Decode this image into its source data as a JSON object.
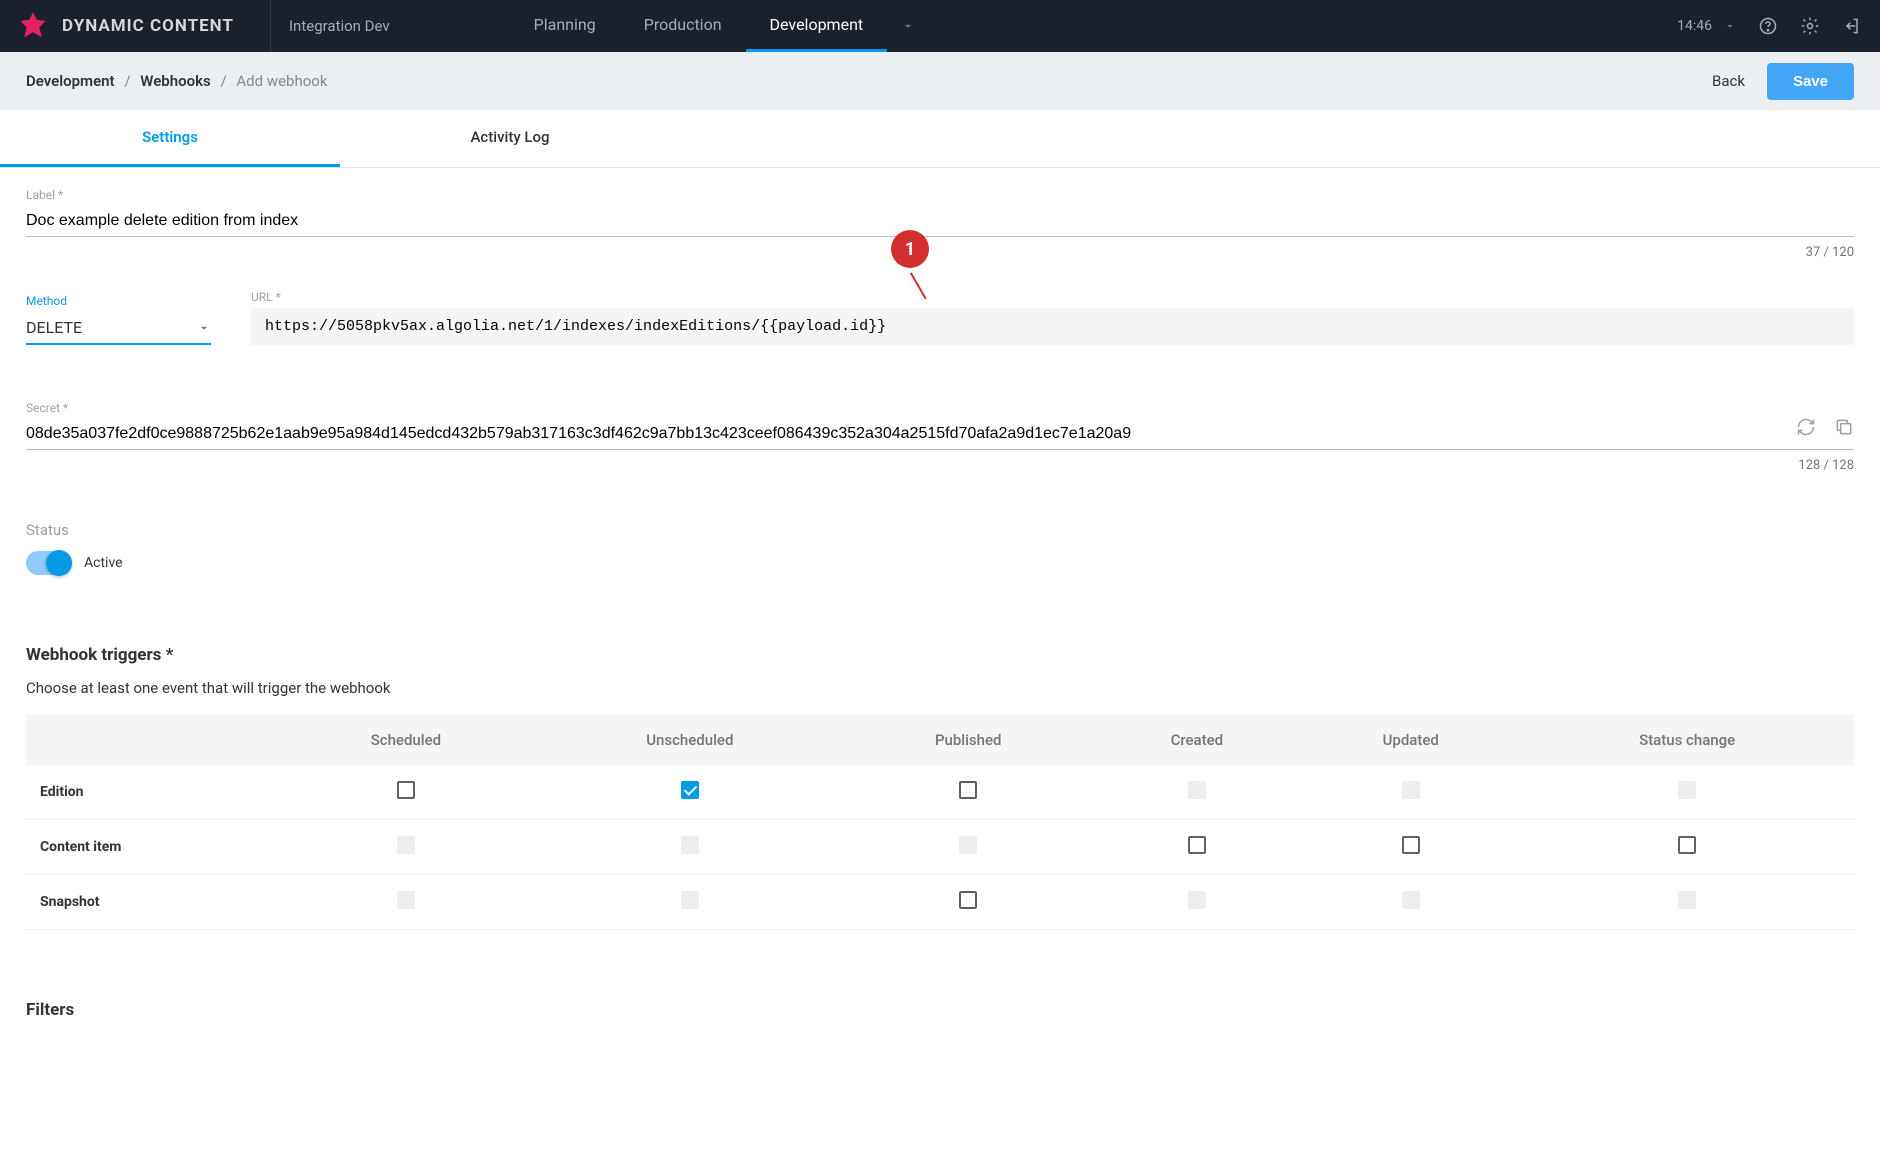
{
  "topnav": {
    "brand": "DYNAMIC CONTENT",
    "hub": "Integration Dev",
    "tabs": [
      {
        "label": "Planning",
        "active": false
      },
      {
        "label": "Production",
        "active": false
      },
      {
        "label": "Development",
        "active": true
      }
    ],
    "time": "14:46"
  },
  "subheader": {
    "crumbs": [
      {
        "label": "Development",
        "link": true
      },
      {
        "label": "Webhooks",
        "link": true
      },
      {
        "label": "Add webhook",
        "link": false
      }
    ],
    "back": "Back",
    "save": "Save"
  },
  "tabs": [
    {
      "label": "Settings",
      "active": true
    },
    {
      "label": "Activity Log",
      "active": false
    }
  ],
  "form": {
    "label_label": "Label *",
    "label_value": "Doc example delete edition from index",
    "label_counter": "37 / 120",
    "method_label": "Method",
    "method_value": "DELETE",
    "url_label": "URL *",
    "url_value": "https://5058pkv5ax.algolia.net/1/indexes/indexEditions/{{payload.id}}",
    "secret_label": "Secret *",
    "secret_value": "08de35a037fe2df0ce9888725b62e1aab9e95a984d145edcd432b579ab317163c3df462c9a7bb13c423ceef086439c352a304a2515fd70afa2a9d1ec7e1a20a9",
    "secret_counter": "128 / 128",
    "status_label": "Status",
    "status_value": "Active"
  },
  "callout": {
    "num": "1"
  },
  "triggers": {
    "title": "Webhook triggers *",
    "desc": "Choose at least one event that will trigger the webhook",
    "cols": [
      "Scheduled",
      "Unscheduled",
      "Published",
      "Created",
      "Updated",
      "Status change"
    ],
    "rows": [
      {
        "name": "Edition",
        "cells": [
          "unchecked",
          "checked",
          "unchecked",
          "disabled",
          "disabled",
          "disabled"
        ]
      },
      {
        "name": "Content item",
        "cells": [
          "disabled",
          "disabled",
          "disabled",
          "unchecked",
          "unchecked",
          "unchecked"
        ]
      },
      {
        "name": "Snapshot",
        "cells": [
          "disabled",
          "disabled",
          "unchecked",
          "disabled",
          "disabled",
          "disabled"
        ]
      }
    ]
  },
  "filters_title": "Filters"
}
